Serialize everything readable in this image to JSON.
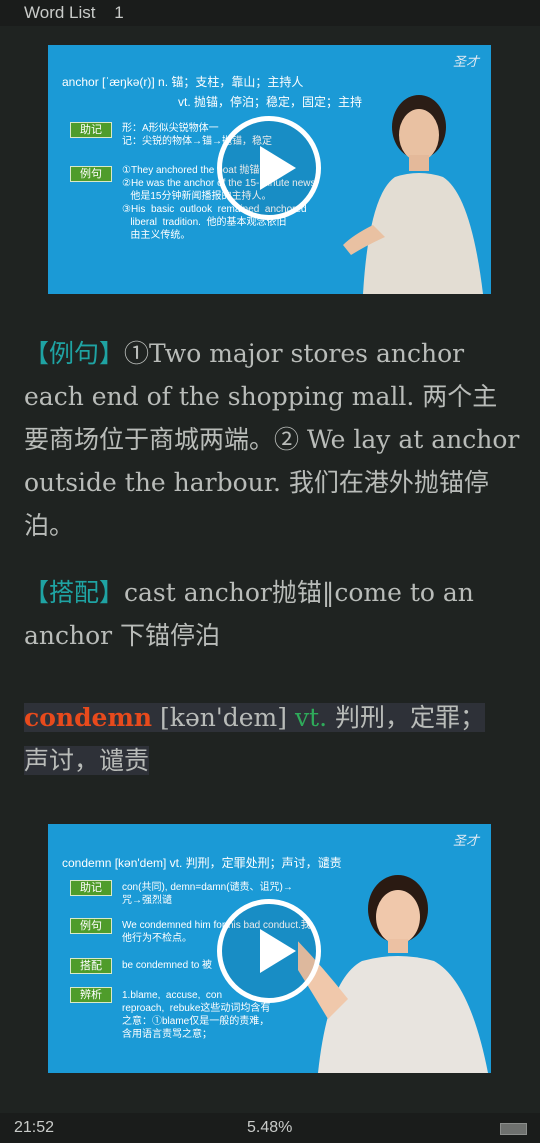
{
  "header": {
    "title": "Word List",
    "count": "1"
  },
  "video1": {
    "logo": "圣才",
    "headline": "anchor [ˈæŋkə(r)] n. 锚；支柱，靠山；主持人",
    "subline": "vt. 抛锚，停泊；稳定，固定；主持",
    "tag_memory": "助记",
    "memory_lines": "形：A形似尖锐物体一\n记：尖锐的物体→锚→抛锚，稳定",
    "tag_example": "例句",
    "example_lines": "①They anchored the boat 抛锚停船。\n②He was the anchor of the 15-minute news\n   他是15分钟新闻播报的主持人。\n③His  basic  outlook  remained  anchored\n   liberal  tradition.  他的基本观念依旧\n   由主义传统。"
  },
  "anchor_entry": {
    "example_label": "【例句】",
    "example_text": "①Two major stores anchor each end of the shopping mall. 两个主要商场位于商城两端。② We lay at anchor outside the harbour. 我们在港外抛锚停泊。",
    "collocation_label": "【搭配】",
    "collocation_text": "cast anchor抛锚‖come to an anchor 下锚停泊"
  },
  "condemn_entry": {
    "word": "condemn",
    "phonetic": "[kən'dem]",
    "pos": "vt.",
    "definition_line1": "判刑，定罪；",
    "definition_line2": "声讨，谴责"
  },
  "video2": {
    "logo": "圣才",
    "headline": "condemn [kən'dem] vt. 判刑，定罪处刑；声讨，谴责",
    "tag_memory": "助记",
    "memory_lines": "con(共同), demn=damn(谴责、诅咒)→\n咒→强烈谴",
    "tag_example": "例句",
    "example_lines": "We condemned him for his bad conduct.我\n他行为不检点。",
    "tag_collocation": "搭配",
    "collocation_lines": "be condemned to 被",
    "tag_analysis": "辨析",
    "analysis_lines": "1.blame,  accuse,  con\nreproach,  rebuke这些动词均含有\n之意：①blame仅是一般的责难，\n含用语言责骂之意；"
  },
  "status": {
    "time": "21:52",
    "progress": "5.48%"
  },
  "colors": {
    "background": "#1f2321",
    "accent_teal": "#1fa3a3",
    "headword": "#e84a1c",
    "pos": "#2eaa5a",
    "slide_blue": "#1b9ad6"
  },
  "icons": {
    "play": "play-icon",
    "battery": "battery-icon"
  }
}
